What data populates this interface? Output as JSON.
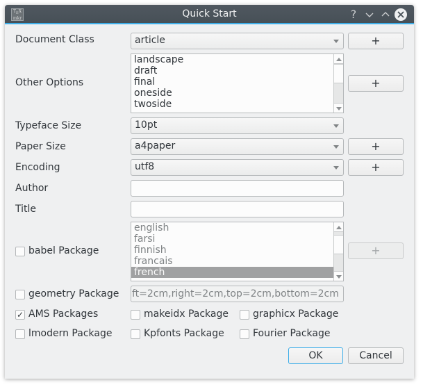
{
  "window": {
    "title": "Quick Start",
    "app_icon_text": "TEX maker",
    "controls": {
      "help": "?",
      "minimize": "⌄",
      "maximize": "⌃",
      "close": "✕"
    }
  },
  "form": {
    "document_class": {
      "label": "Document Class",
      "value": "article",
      "add_label": "+"
    },
    "other_options": {
      "label": "Other Options",
      "items": [
        "landscape",
        "draft",
        "final",
        "oneside",
        "twoside"
      ],
      "add_label": "+",
      "scroll_fraction": 0.0
    },
    "typeface_size": {
      "label": "Typeface Size",
      "value": "10pt"
    },
    "paper_size": {
      "label": "Paper Size",
      "value": "a4paper",
      "add_label": "+"
    },
    "encoding": {
      "label": "Encoding",
      "value": "utf8",
      "add_label": "+"
    },
    "author": {
      "label": "Author",
      "value": ""
    },
    "title": {
      "label": "Title",
      "value": ""
    },
    "babel": {
      "label": "babel Package",
      "checked": false,
      "items": [
        "english",
        "farsi",
        "finnish",
        "francais",
        "french"
      ],
      "selected": "french",
      "add_label": "+",
      "enabled": false
    },
    "geometry": {
      "label": "geometry Package",
      "checked": false,
      "value": "ft=2cm,right=2cm,top=2cm,bottom=2cm",
      "enabled": false
    },
    "packages": [
      {
        "label": "AMS Packages",
        "checked": true
      },
      {
        "label": "makeidx Package",
        "checked": false
      },
      {
        "label": "graphicx Package",
        "checked": false
      },
      {
        "label": "lmodern Package",
        "checked": false
      },
      {
        "label": "Kpfonts Package",
        "checked": false
      },
      {
        "label": "Fourier Package",
        "checked": false
      }
    ]
  },
  "buttons": {
    "ok": "OK",
    "cancel": "Cancel"
  },
  "colors": {
    "accent": "#3daee9",
    "titlebar": "#475057",
    "window_bg": "#eff0f1",
    "selection": "#a0a1a2"
  }
}
